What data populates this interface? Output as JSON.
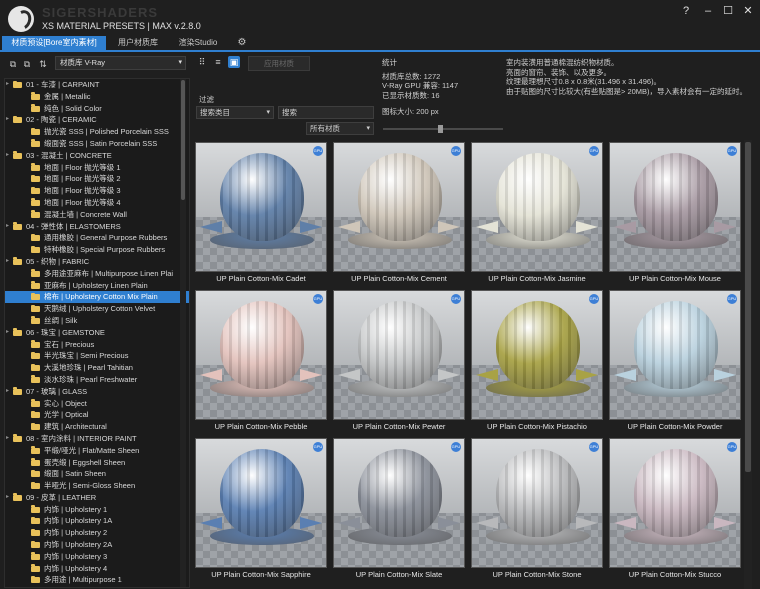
{
  "app": {
    "brand": "SIGERSHADERS",
    "title": "XS MATERIAL PRESETS | MAX v.2.8.0",
    "help": "?",
    "minimize": "–",
    "maximize": "☐",
    "close": "✕"
  },
  "tabs": [
    {
      "label": "材质预设[Bore室内素材]"
    },
    {
      "label": "用户材质库"
    },
    {
      "label": "渲染Studio"
    },
    {
      "label": "⚙"
    }
  ],
  "library": {
    "selected": "材质库 V-Ray"
  },
  "toolbar": {
    "apply_label": "应用材质"
  },
  "filter": {
    "label": "过滤",
    "category_placeholder": "搜索类目",
    "search_placeholder": "搜索",
    "material_select": "所有材质"
  },
  "stats": {
    "heading": "统计",
    "total": "材质库总数: 1272",
    "gpu": "V-Ray GPU 兼容: 1147",
    "shown": "已显示材质数: 16",
    "icon_size": "图标大小: 200 px"
  },
  "description": [
    "室内装潢用普通棉混纺织物材质。",
    "亮面的窗帘、装饰、以及更多。",
    "纹理最理想尺寸0.8 x 0.8米(31.496 x 31.496)。",
    "由于贴图的尺寸比较大(有些贴图是> 20MB)，导入素材会有一定的延时。"
  ],
  "tree": [
    {
      "level": 0,
      "label": "01 - 车漆 | CARPAINT"
    },
    {
      "level": 1,
      "label": "金属 | Metallic"
    },
    {
      "level": 1,
      "label": "纯色 | Solid Color"
    },
    {
      "level": 0,
      "label": "02 - 陶瓷 | CERAMIC"
    },
    {
      "level": 1,
      "label": "抛光瓷 SSS | Polished Porcelain SSS"
    },
    {
      "level": 1,
      "label": "缎面瓷 SSS | Satin Porcelain SSS"
    },
    {
      "level": 0,
      "label": "03 - 混凝土 | CONCRETE"
    },
    {
      "level": 1,
      "label": "地面 | Floor 抛光等级 1"
    },
    {
      "level": 1,
      "label": "地面 | Floor 抛光等级 2"
    },
    {
      "level": 1,
      "label": "地面 | Floor 抛光等级 3"
    },
    {
      "level": 1,
      "label": "地面 | Floor 抛光等级 4"
    },
    {
      "level": 1,
      "label": "混凝土墙 | Concrete Wall"
    },
    {
      "level": 0,
      "label": "04 - 弹性体 | ELASTOMERS"
    },
    {
      "level": 1,
      "label": "通用橡胶 | General Purpose Rubbers"
    },
    {
      "level": 1,
      "label": "特种橡胶 | Special Purpose Rubbers"
    },
    {
      "level": 0,
      "label": "05 - 织物 | FABRIC"
    },
    {
      "level": 1,
      "label": "多用途亚麻布 | Multipurpose Linen Plai"
    },
    {
      "level": 1,
      "label": "亚麻布 | Upholstery Linen Plain"
    },
    {
      "level": 1,
      "label": "棉布 | Upholstery Cotton Mix Plain",
      "selected": true
    },
    {
      "level": 1,
      "label": "天鹅绒 | Upholstery Cotton Velvet"
    },
    {
      "level": 1,
      "label": "丝绸 | Silk"
    },
    {
      "level": 0,
      "label": "06 - 珠宝 | GEMSTONE"
    },
    {
      "level": 1,
      "label": "宝石 | Precious"
    },
    {
      "level": 1,
      "label": "半光珠宝 | Semi Precious"
    },
    {
      "level": 1,
      "label": "大溪地珍珠 | Pearl Tahitian"
    },
    {
      "level": 1,
      "label": "淡水珍珠 | Pearl Freshwater"
    },
    {
      "level": 0,
      "label": "07 - 玻璃 | GLASS"
    },
    {
      "level": 1,
      "label": "实心 | Object"
    },
    {
      "level": 1,
      "label": "光学 | Optical"
    },
    {
      "level": 1,
      "label": "建筑 | Architectural"
    },
    {
      "level": 0,
      "label": "08 - 室内涂料 | INTERIOR PAINT"
    },
    {
      "level": 1,
      "label": "平缎/哑光 | Flat/Matte Sheen"
    },
    {
      "level": 1,
      "label": "蛋壳缎 | Eggshell Sheen"
    },
    {
      "level": 1,
      "label": "缎面 | Satin Sheen"
    },
    {
      "level": 1,
      "label": "半哑光 | Semi-Gloss Sheen"
    },
    {
      "level": 0,
      "label": "09 - 皮革 | LEATHER"
    },
    {
      "level": 1,
      "label": "内饰 | Upholstery 1"
    },
    {
      "level": 1,
      "label": "内饰 | Upholstery 1A"
    },
    {
      "level": 1,
      "label": "内饰 | Upholstery 2"
    },
    {
      "level": 1,
      "label": "内饰 | Upholstery 2A"
    },
    {
      "level": 1,
      "label": "内饰 | Upholstery 3"
    },
    {
      "level": 1,
      "label": "内饰 | Upholstery 4"
    },
    {
      "level": 1,
      "label": "多用途 | Multipurpose 1"
    }
  ],
  "materials": [
    {
      "name": "UP Plain Cotton-Mix Cadet",
      "color": "#5f7fa8"
    },
    {
      "name": "UP Plain Cotton-Mix Cement",
      "color": "#cfc6b9"
    },
    {
      "name": "UP Plain Cotton-Mix Jasmine",
      "color": "#e4e3d6"
    },
    {
      "name": "UP Plain Cotton-Mix Mouse",
      "color": "#a89aa3"
    },
    {
      "name": "UP Plain Cotton-Mix Pebble",
      "color": "#e3c2bc"
    },
    {
      "name": "UP Plain Cotton-Mix Pewter",
      "color": "#c4c6c7"
    },
    {
      "name": "UP Plain Cotton-Mix Pistachio",
      "color": "#a8a245"
    },
    {
      "name": "UP Plain Cotton-Mix Powder",
      "color": "#b9d1de"
    },
    {
      "name": "UP Plain Cotton-Mix Sapphire",
      "color": "#5a7fb2"
    },
    {
      "name": "UP Plain Cotton-Mix Slate",
      "color": "#8a8f99"
    },
    {
      "name": "UP Plain Cotton-Mix Stone",
      "color": "#b8b9bb"
    },
    {
      "name": "UP Plain Cotton-Mix Stucco",
      "color": "#c9b7c0"
    }
  ],
  "badge": "GPU"
}
